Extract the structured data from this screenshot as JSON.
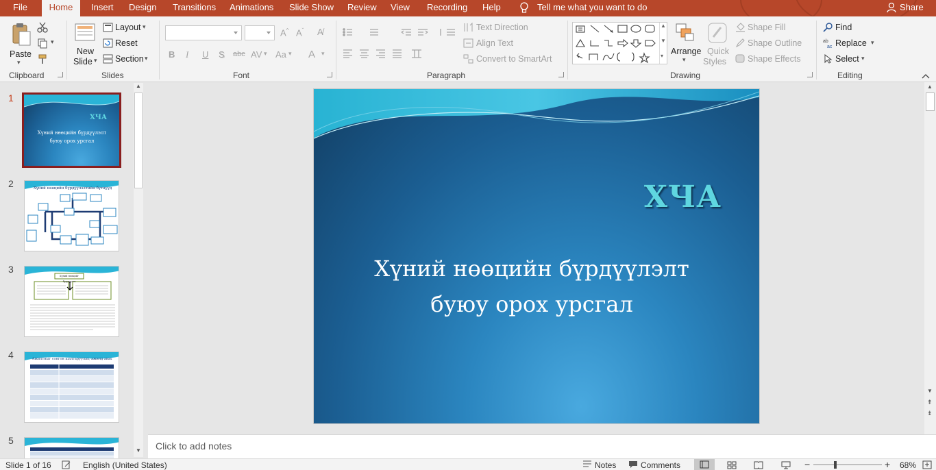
{
  "tabs": [
    {
      "label": "File"
    },
    {
      "label": "Home",
      "active": true
    },
    {
      "label": "Insert"
    },
    {
      "label": "Design"
    },
    {
      "label": "Transitions"
    },
    {
      "label": "Animations"
    },
    {
      "label": "Slide Show"
    },
    {
      "label": "Review"
    },
    {
      "label": "View"
    },
    {
      "label": "Recording"
    },
    {
      "label": "Help"
    }
  ],
  "tell_me": "Tell me what you want to do",
  "share": "Share",
  "colors": {
    "accent": "#b7472a",
    "selected_thumb_border": "#8a1e1e"
  },
  "ribbon": {
    "clipboard": {
      "paste": "Paste",
      "label": "Clipboard"
    },
    "slides": {
      "new_slide_1": "New",
      "new_slide_2": "Slide",
      "layout": "Layout",
      "reset": "Reset",
      "section": "Section",
      "label": "Slides"
    },
    "font": {
      "bold": "B",
      "italic": "I",
      "underline": "U",
      "shadow": "S",
      "strike": "abc",
      "spacing": "AV",
      "case": "Aa",
      "color": "A",
      "label": "Font"
    },
    "paragraph": {
      "text_direction": "Text Direction",
      "align_text": "Align Text",
      "smartart": "Convert to SmartArt",
      "label": "Paragraph"
    },
    "drawing": {
      "arrange": "Arrange",
      "quick_styles_1": "Quick",
      "quick_styles_2": "Styles",
      "shape_fill": "Shape Fill",
      "shape_outline": "Shape Outline",
      "shape_effects": "Shape Effects",
      "label": "Drawing"
    },
    "editing": {
      "find": "Find",
      "replace": "Replace",
      "select": "Select",
      "label": "Editing"
    }
  },
  "slides": [
    {
      "number": "1",
      "title": "ХЧА",
      "subtitle": "Хүний нөөцийн бүрдүүлэлт буюу орох урсгал",
      "selected": true
    },
    {
      "number": "2",
      "title": "Хүний нөөцийн бүрдүүлэлтийн бүтцүүд"
    },
    {
      "number": "3",
      "title": "Хүний нөөцийг бүрдүүлэх"
    },
    {
      "number": "4",
      "title": "Ажилтныг сонгон шалгаруулах, ажилд авах"
    },
    {
      "number": "5",
      "title": ""
    }
  ],
  "main_slide": {
    "title": "ХЧА",
    "subtitle_line1": "Хүний нөөцийн бүрдүүлэлт",
    "subtitle_line2": "буюу орох урсгал"
  },
  "notes_placeholder": "Click to add notes",
  "status": {
    "slide_counter": "Slide 1 of 16",
    "language": "English (United States)",
    "notes": "Notes",
    "comments": "Comments",
    "zoom": "68%"
  }
}
